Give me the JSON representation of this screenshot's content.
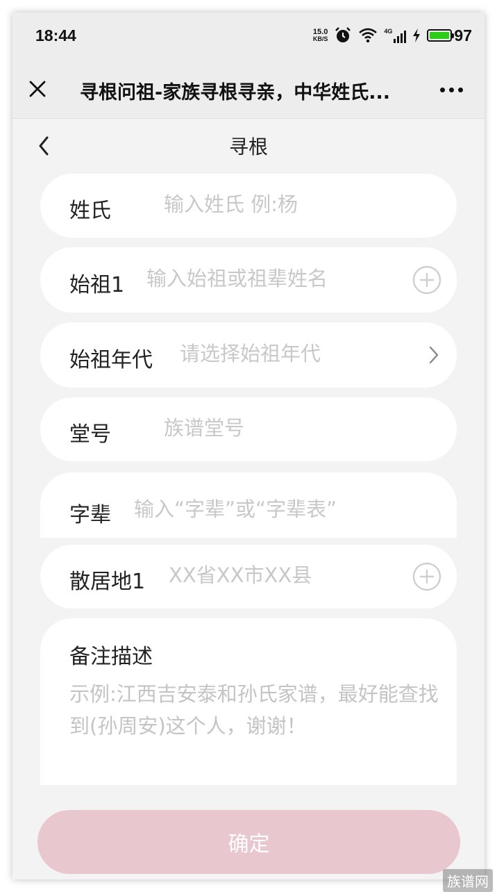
{
  "status_bar": {
    "time": "18:44",
    "net_speed_value": "15.0",
    "net_speed_unit": "KB/S",
    "network_type": "4G",
    "battery_level": "97",
    "battery_fraction": 0.97,
    "battery_color": "#2ecc1a"
  },
  "title_bar": {
    "title": "寻根问祖-家族寻根寻亲，中华姓氏..."
  },
  "page": {
    "title": "寻根"
  },
  "form": {
    "surname": {
      "label": "姓氏",
      "placeholder": "输入姓氏 例:杨"
    },
    "ancestor": {
      "label": "始祖1",
      "placeholder": "输入始祖或祖辈姓名"
    },
    "ancestor_era": {
      "label": "始祖年代",
      "placeholder": "请选择始祖年代"
    },
    "hall_name": {
      "label": "堂号",
      "placeholder": "族谱堂号"
    },
    "generation_names": {
      "label": "字辈",
      "placeholder": "输入“字辈”或“字辈表”"
    },
    "residence": {
      "label": "散居地1",
      "placeholder": "XX省XX市XX县"
    },
    "remarks": {
      "label": "备注描述",
      "placeholder": "示例:江西吉安泰和孙氏家谱，最好能查找到(孙周安)这个人，谢谢！"
    }
  },
  "confirm_button": {
    "label": "确定",
    "color": "#e8c7cf"
  },
  "watermark": {
    "text": "族谱网"
  }
}
